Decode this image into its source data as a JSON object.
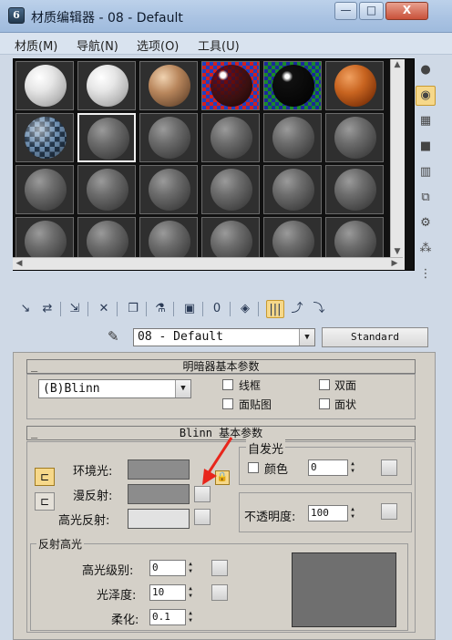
{
  "window": {
    "title": "材质编辑器 - 08 - Default",
    "app_icon": "3dsmax-logo",
    "controls": {
      "minimize": "—",
      "maximize": "□",
      "close": "X"
    }
  },
  "menu": [
    "材质(M)",
    "导航(N)",
    "选项(O)",
    "工具(U)"
  ],
  "sample_slots": {
    "rows": 4,
    "columns": 6,
    "active_slot": 8,
    "slots": [
      "white-glossy",
      "white-glossy",
      "tan-matte",
      "glass-red-checker",
      "black-reflective-checker",
      "orange",
      "blue-checker",
      "gray-default",
      "gray-default",
      "gray-default",
      "gray-default",
      "gray-default",
      "gray-default",
      "gray-default",
      "gray-default",
      "gray-default",
      "gray-default",
      "gray-default",
      "gray-default",
      "gray-default",
      "gray-default",
      "gray-default",
      "gray-default",
      "gray-default"
    ]
  },
  "side_toolbar": [
    "sample-type-icon",
    "backlight-icon",
    "background-checker-icon",
    "sample-uv-tiling-icon",
    "video-color-check-icon",
    "make-preview-icon",
    "options-icon",
    "select-by-material-icon",
    "material-navigator-icon"
  ],
  "bottom_toolbar": [
    "get-material-icon",
    "put-to-scene-icon",
    "assign-to-selection-icon",
    "reset-icon",
    "make-copy-icon",
    "make-unique-icon",
    "put-to-library-icon",
    "material-id-channel-icon",
    "show-map-in-viewport-icon",
    "show-end-result-icon",
    "go-to-parent-icon",
    "go-forward-sibling-icon"
  ],
  "material": {
    "name": "08 - Default",
    "type_button": "Standard"
  },
  "shader_basic": {
    "header": "明暗器基本参数",
    "shader": "(B)Blinn",
    "options": [
      {
        "label": "线框",
        "checked": false
      },
      {
        "label": "双面",
        "checked": false
      },
      {
        "label": "面贴图",
        "checked": false
      },
      {
        "label": "面状",
        "checked": false
      }
    ]
  },
  "blinn_basic": {
    "header": "Blinn 基本参数",
    "ambient_label": "环境光:",
    "diffuse_label": "漫反射:",
    "specular_label": "高光反射:",
    "colors": {
      "ambient": "#8c8c8c",
      "diffuse": "#8c8c8c",
      "specular": "#e2e2e2",
      "accent": "#f6d88a"
    },
    "self_illum": {
      "group_label": "自发光",
      "color_label": "颜色",
      "value": "0"
    },
    "opacity": {
      "label": "不透明度:",
      "value": "100"
    }
  },
  "specular_highlights": {
    "group_label": "反射高光",
    "level_label": "高光级别:",
    "level_value": "0",
    "gloss_label": "光泽度:",
    "gloss_value": "10",
    "soften_label": "柔化:",
    "soften_value": "0.1"
  }
}
